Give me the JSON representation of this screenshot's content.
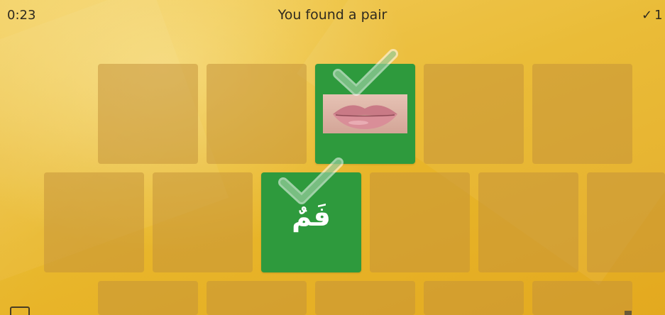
{
  "game": {
    "timer": "0:23",
    "status_message": "You found a pair",
    "score_check": "✓",
    "score_value": "1"
  },
  "cards": {
    "matched_word": "فَمٌ",
    "matched_image": "lips-photo"
  },
  "colors": {
    "background": "#e9b82c",
    "card_back": "#c4923a",
    "matched_card": "#2e9a3d",
    "text": "#2f2a1f"
  }
}
